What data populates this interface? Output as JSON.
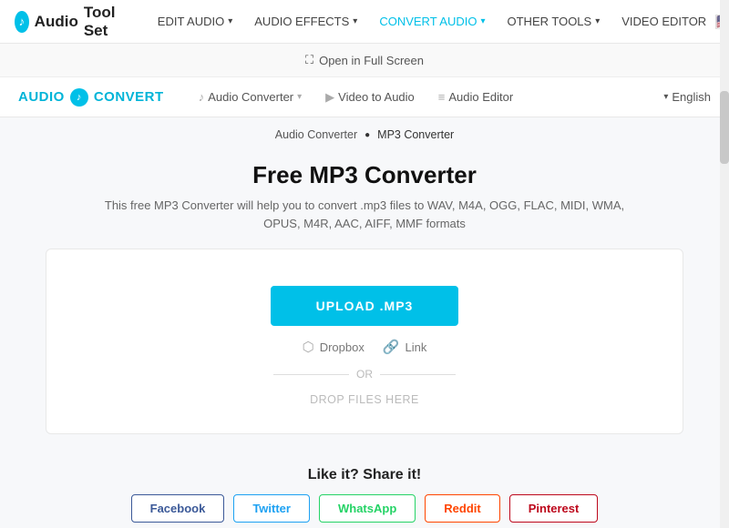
{
  "top_nav": {
    "logo_text": "Audio",
    "logo_suffix": "Tool Set",
    "nav_items": [
      {
        "label": "EDIT AUDIO",
        "has_caret": true,
        "active": false
      },
      {
        "label": "AUDIO EFFECTS",
        "has_caret": true,
        "active": false
      },
      {
        "label": "CONVERT AUDIO",
        "has_caret": true,
        "active": true
      },
      {
        "label": "OTHER TOOLS",
        "has_caret": true,
        "active": false
      },
      {
        "label": "VIDEO EDITOR",
        "has_caret": false,
        "active": false
      }
    ],
    "flag_emoji": "🇺🇸"
  },
  "fullscreen_bar": {
    "label": "Open in Full Screen",
    "icon": "⛶"
  },
  "second_nav": {
    "logo_audio": "AUDIO",
    "logo_convert": "CONVERT",
    "links": [
      {
        "icon": "♪",
        "label": "Audio Converter",
        "has_caret": true
      },
      {
        "icon": "▶",
        "label": "Video to Audio",
        "has_caret": false
      },
      {
        "icon": "≡",
        "label": "Audio Editor",
        "has_caret": false
      }
    ],
    "language": "English"
  },
  "breadcrumb": {
    "parent": "Audio Converter",
    "current": "MP3 Converter"
  },
  "page": {
    "title": "Free MP3 Converter",
    "subtitle": "This free MP3 Converter will help you to convert .mp3 files to WAV, M4A, OGG, FLAC, MIDI, WMA, OPUS, M4R, AAC, AIFF, MMF formats"
  },
  "upload": {
    "button_label": "UPLOAD .MP3",
    "dropbox_label": "Dropbox",
    "link_label": "Link",
    "or_label": "OR",
    "drop_label": "DROP FILES HERE"
  },
  "share": {
    "title": "Like it? Share it!",
    "buttons": [
      {
        "label": "Facebook",
        "class": "facebook"
      },
      {
        "label": "Twitter",
        "class": "twitter"
      },
      {
        "label": "WhatsApp",
        "class": "whatsapp"
      },
      {
        "label": "Reddit",
        "class": "reddit"
      },
      {
        "label": "Pinterest",
        "class": "pinterest"
      }
    ]
  }
}
